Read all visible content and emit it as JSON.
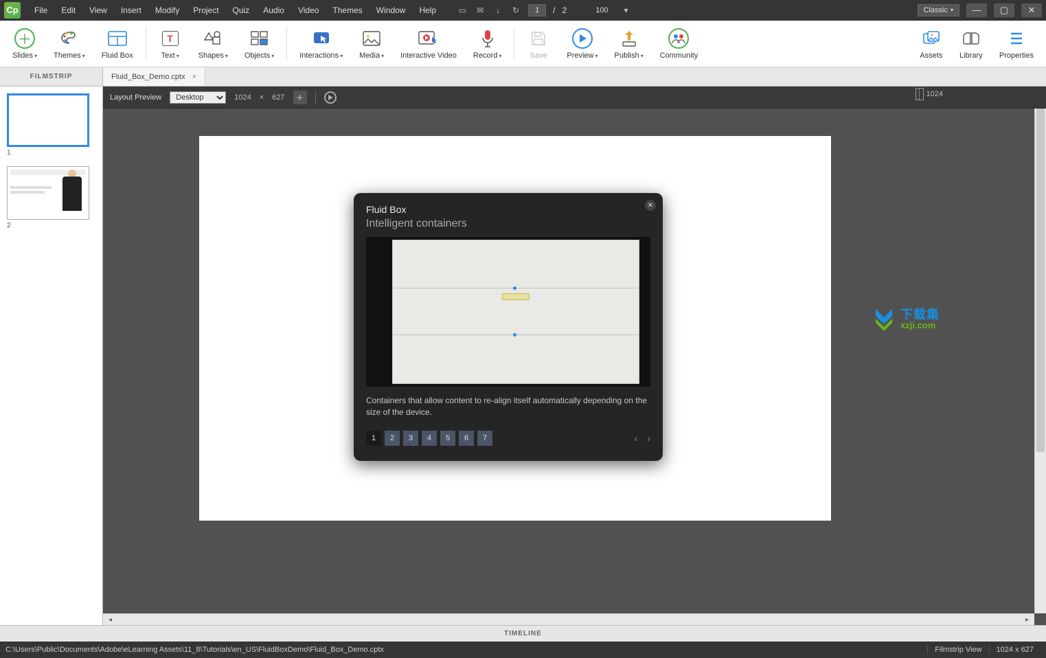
{
  "app": {
    "logo": "Cp"
  },
  "menu": {
    "file": "File",
    "edit": "Edit",
    "view": "View",
    "insert": "Insert",
    "modify": "Modify",
    "project": "Project",
    "quiz": "Quiz",
    "audio": "Audio",
    "video": "Video",
    "themes": "Themes",
    "window": "Window",
    "help": "Help"
  },
  "pagebox": {
    "current": "1",
    "sep": "/",
    "total": "2"
  },
  "zoom": "100",
  "workspace_btn": "Classic",
  "toolbar": {
    "slides": "Slides",
    "themes": "Themes",
    "fluidbox": "Fluid Box",
    "text": "Text",
    "shapes": "Shapes",
    "objects": "Objects",
    "interactions": "Interactions",
    "media": "Media",
    "interactive_video": "Interactive Video",
    "record": "Record",
    "save": "Save",
    "preview": "Preview",
    "publish": "Publish",
    "community": "Community",
    "assets": "Assets",
    "library": "Library",
    "properties": "Properties"
  },
  "filmstrip_header": "FILMSTRIP",
  "doc_tab": "Fluid_Box_Demo.cptx",
  "slides": {
    "s1": "1",
    "s2": "2"
  },
  "layoutbar": {
    "label": "Layout Preview",
    "device": "Desktop",
    "w": "1024",
    "x": "×",
    "h": "627",
    "guide_value": "1024"
  },
  "popover": {
    "title": "Fluid Box",
    "subtitle": "Intelligent containers",
    "desc": "Containers that allow content to re-align itself automatically depending on the size of the device.",
    "pages": {
      "p1": "1",
      "p2": "2",
      "p3": "3",
      "p4": "4",
      "p5": "5",
      "p6": "6",
      "p7": "7"
    }
  },
  "timeline_label": "TIMELINE",
  "status": {
    "path": "C:\\Users\\Public\\Documents\\Adobe\\eLearning Assets\\11_8\\Tutorials\\en_US\\FluidBoxDemo\\Fluid_Box_Demo.cptx",
    "view": "Filmstrip View",
    "dims": "1024 x 627"
  },
  "watermark": {
    "top": "下载集",
    "bottom": "xzji.com"
  }
}
